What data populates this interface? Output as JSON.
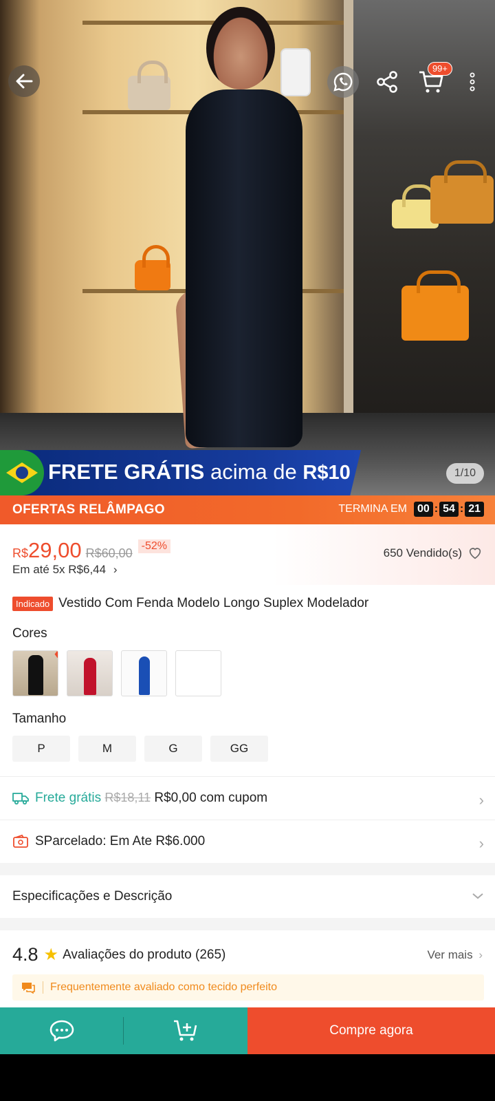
{
  "hero": {
    "image_counter": "1/10",
    "cart_badge": "99+"
  },
  "promo_banner": {
    "text_bold": "FRETE GRÁTIS",
    "text_mid": "acima de",
    "text_value": "R$10"
  },
  "flash": {
    "title": "OFERTAS RELÂMPAGO",
    "ends_label": "TERMINA EM",
    "hours": "00",
    "minutes": "54",
    "seconds": "21"
  },
  "price": {
    "currency": "R$",
    "value": "29,00",
    "old_price": "R$60,00",
    "discount": "-52%",
    "installment": "Em até 5x R$6,44",
    "sold": "650 Vendido(s)"
  },
  "product": {
    "tag": "Indicado",
    "title": "Vestido Com Fenda Modelo Longo Suplex Modelador"
  },
  "variants": {
    "colors_label": "Cores",
    "size_label": "Tamanho",
    "sizes": [
      "P",
      "M",
      "G",
      "GG"
    ]
  },
  "shipping": {
    "label": "Frete grátis",
    "old": "R$18,11",
    "new": "R$0,00 com cupom"
  },
  "installment_row": {
    "text": "SParcelado: Em Ate R$6.000"
  },
  "specs": {
    "label": "Especificações e Descrição"
  },
  "reviews": {
    "score": "4.8",
    "label": "Avaliações do produto (265)",
    "see_more": "Ver mais",
    "hint": "Frequentemente avaliado como tecido perfeito"
  },
  "bottom": {
    "buy_label": "Compre agora"
  },
  "colors": {
    "accent": "#ee4d2d",
    "teal": "#26aa99"
  }
}
